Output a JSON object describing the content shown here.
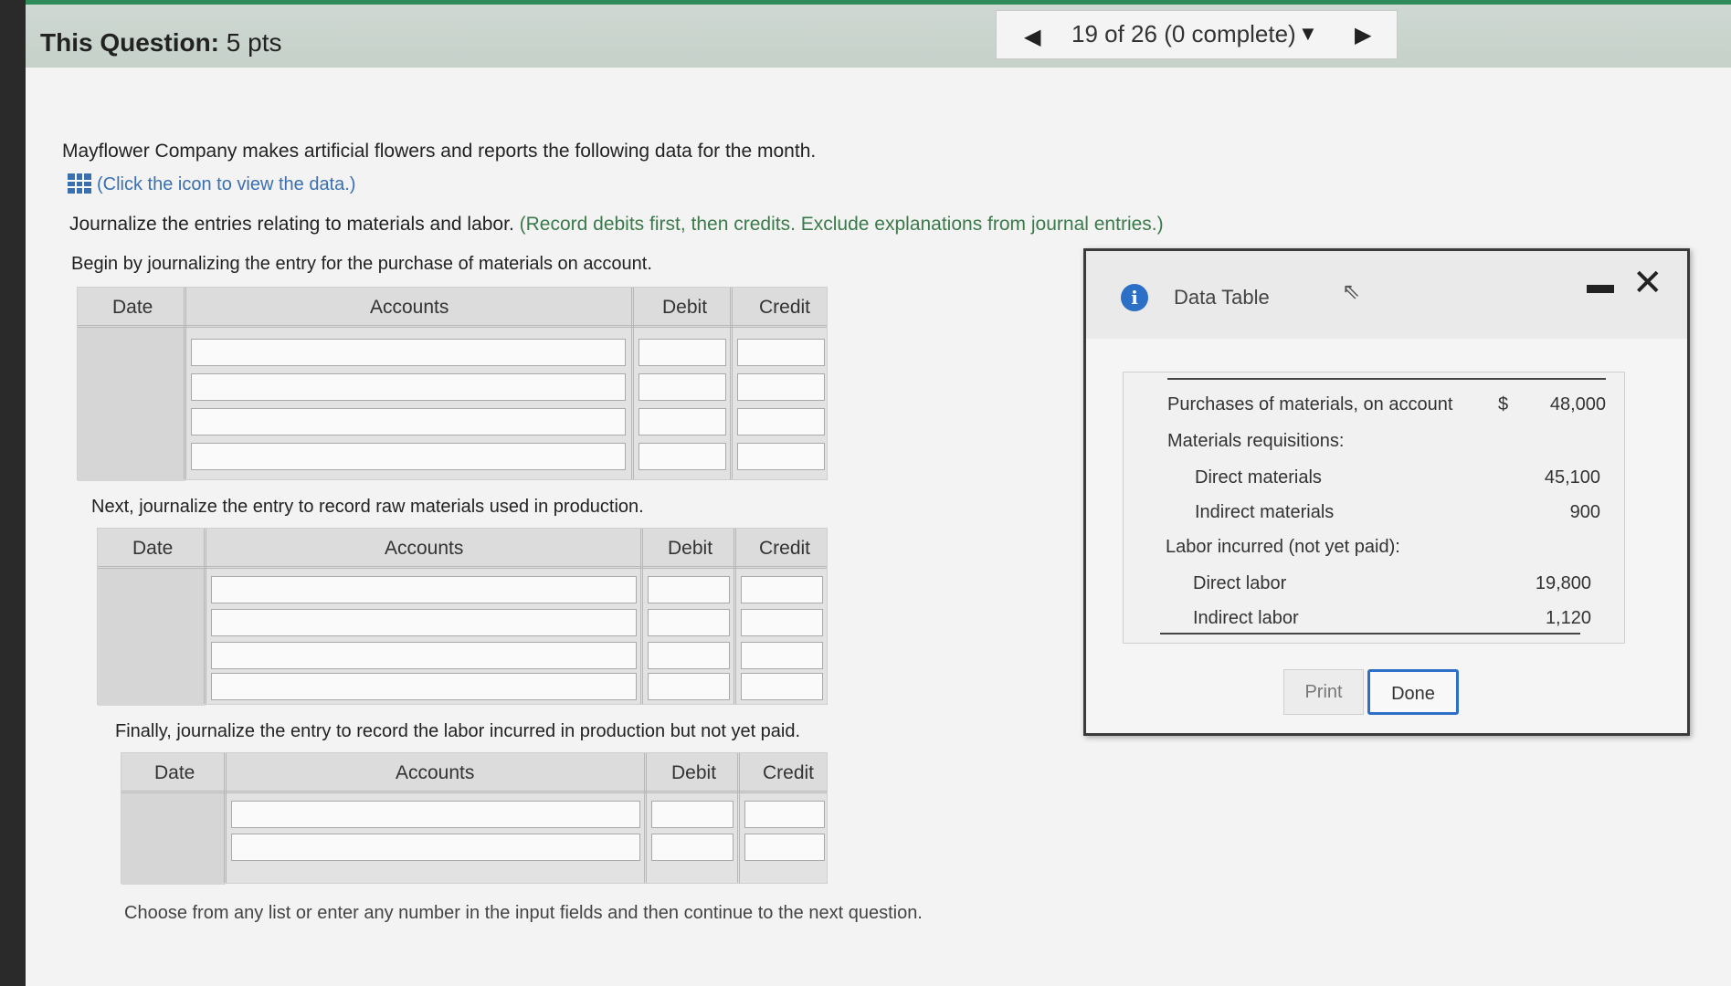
{
  "header": {
    "question_label": "This Question:",
    "question_points": "5 pts",
    "progress": "19 of 26 (0 complete)"
  },
  "problem": {
    "intro": "Mayflower Company makes artificial flowers and reports the following data for the month.",
    "data_link": "(Click the icon to view the data.)",
    "instruction": "Journalize the entries relating to materials and labor.",
    "instruction_note": "(Record debits first, then credits. Exclude explanations from journal entries.)",
    "step1": "Begin by journalizing the entry for the purchase of materials on account.",
    "step2": "Next, journalize the entry to record raw materials used in production.",
    "step3": "Finally, journalize the entry to record the labor incurred in production but not yet paid.",
    "footer": "Choose from any list or enter any number in the input fields and then continue to the next question."
  },
  "journal_headers": {
    "date": "Date",
    "accounts": "Accounts",
    "debit": "Debit",
    "credit": "Credit"
  },
  "dialog": {
    "title": "Data Table",
    "rows": [
      {
        "label": "Purchases of materials, on account",
        "currency": "$",
        "value": "48,000"
      },
      {
        "label": "Materials requisitions:",
        "value": ""
      },
      {
        "label": "Direct materials",
        "value": "45,100"
      },
      {
        "label": "Indirect materials",
        "value": "900"
      },
      {
        "label": "Labor incurred (not yet paid):",
        "value": ""
      },
      {
        "label": "Direct labor",
        "value": "19,800"
      },
      {
        "label": "Indirect labor",
        "value": "1,120"
      }
    ],
    "print_label": "Print",
    "done_label": "Done"
  },
  "colors": {
    "accent": "#2c6fc7",
    "topbar_green": "#2f8c5a",
    "link": "#3a6fb0"
  }
}
